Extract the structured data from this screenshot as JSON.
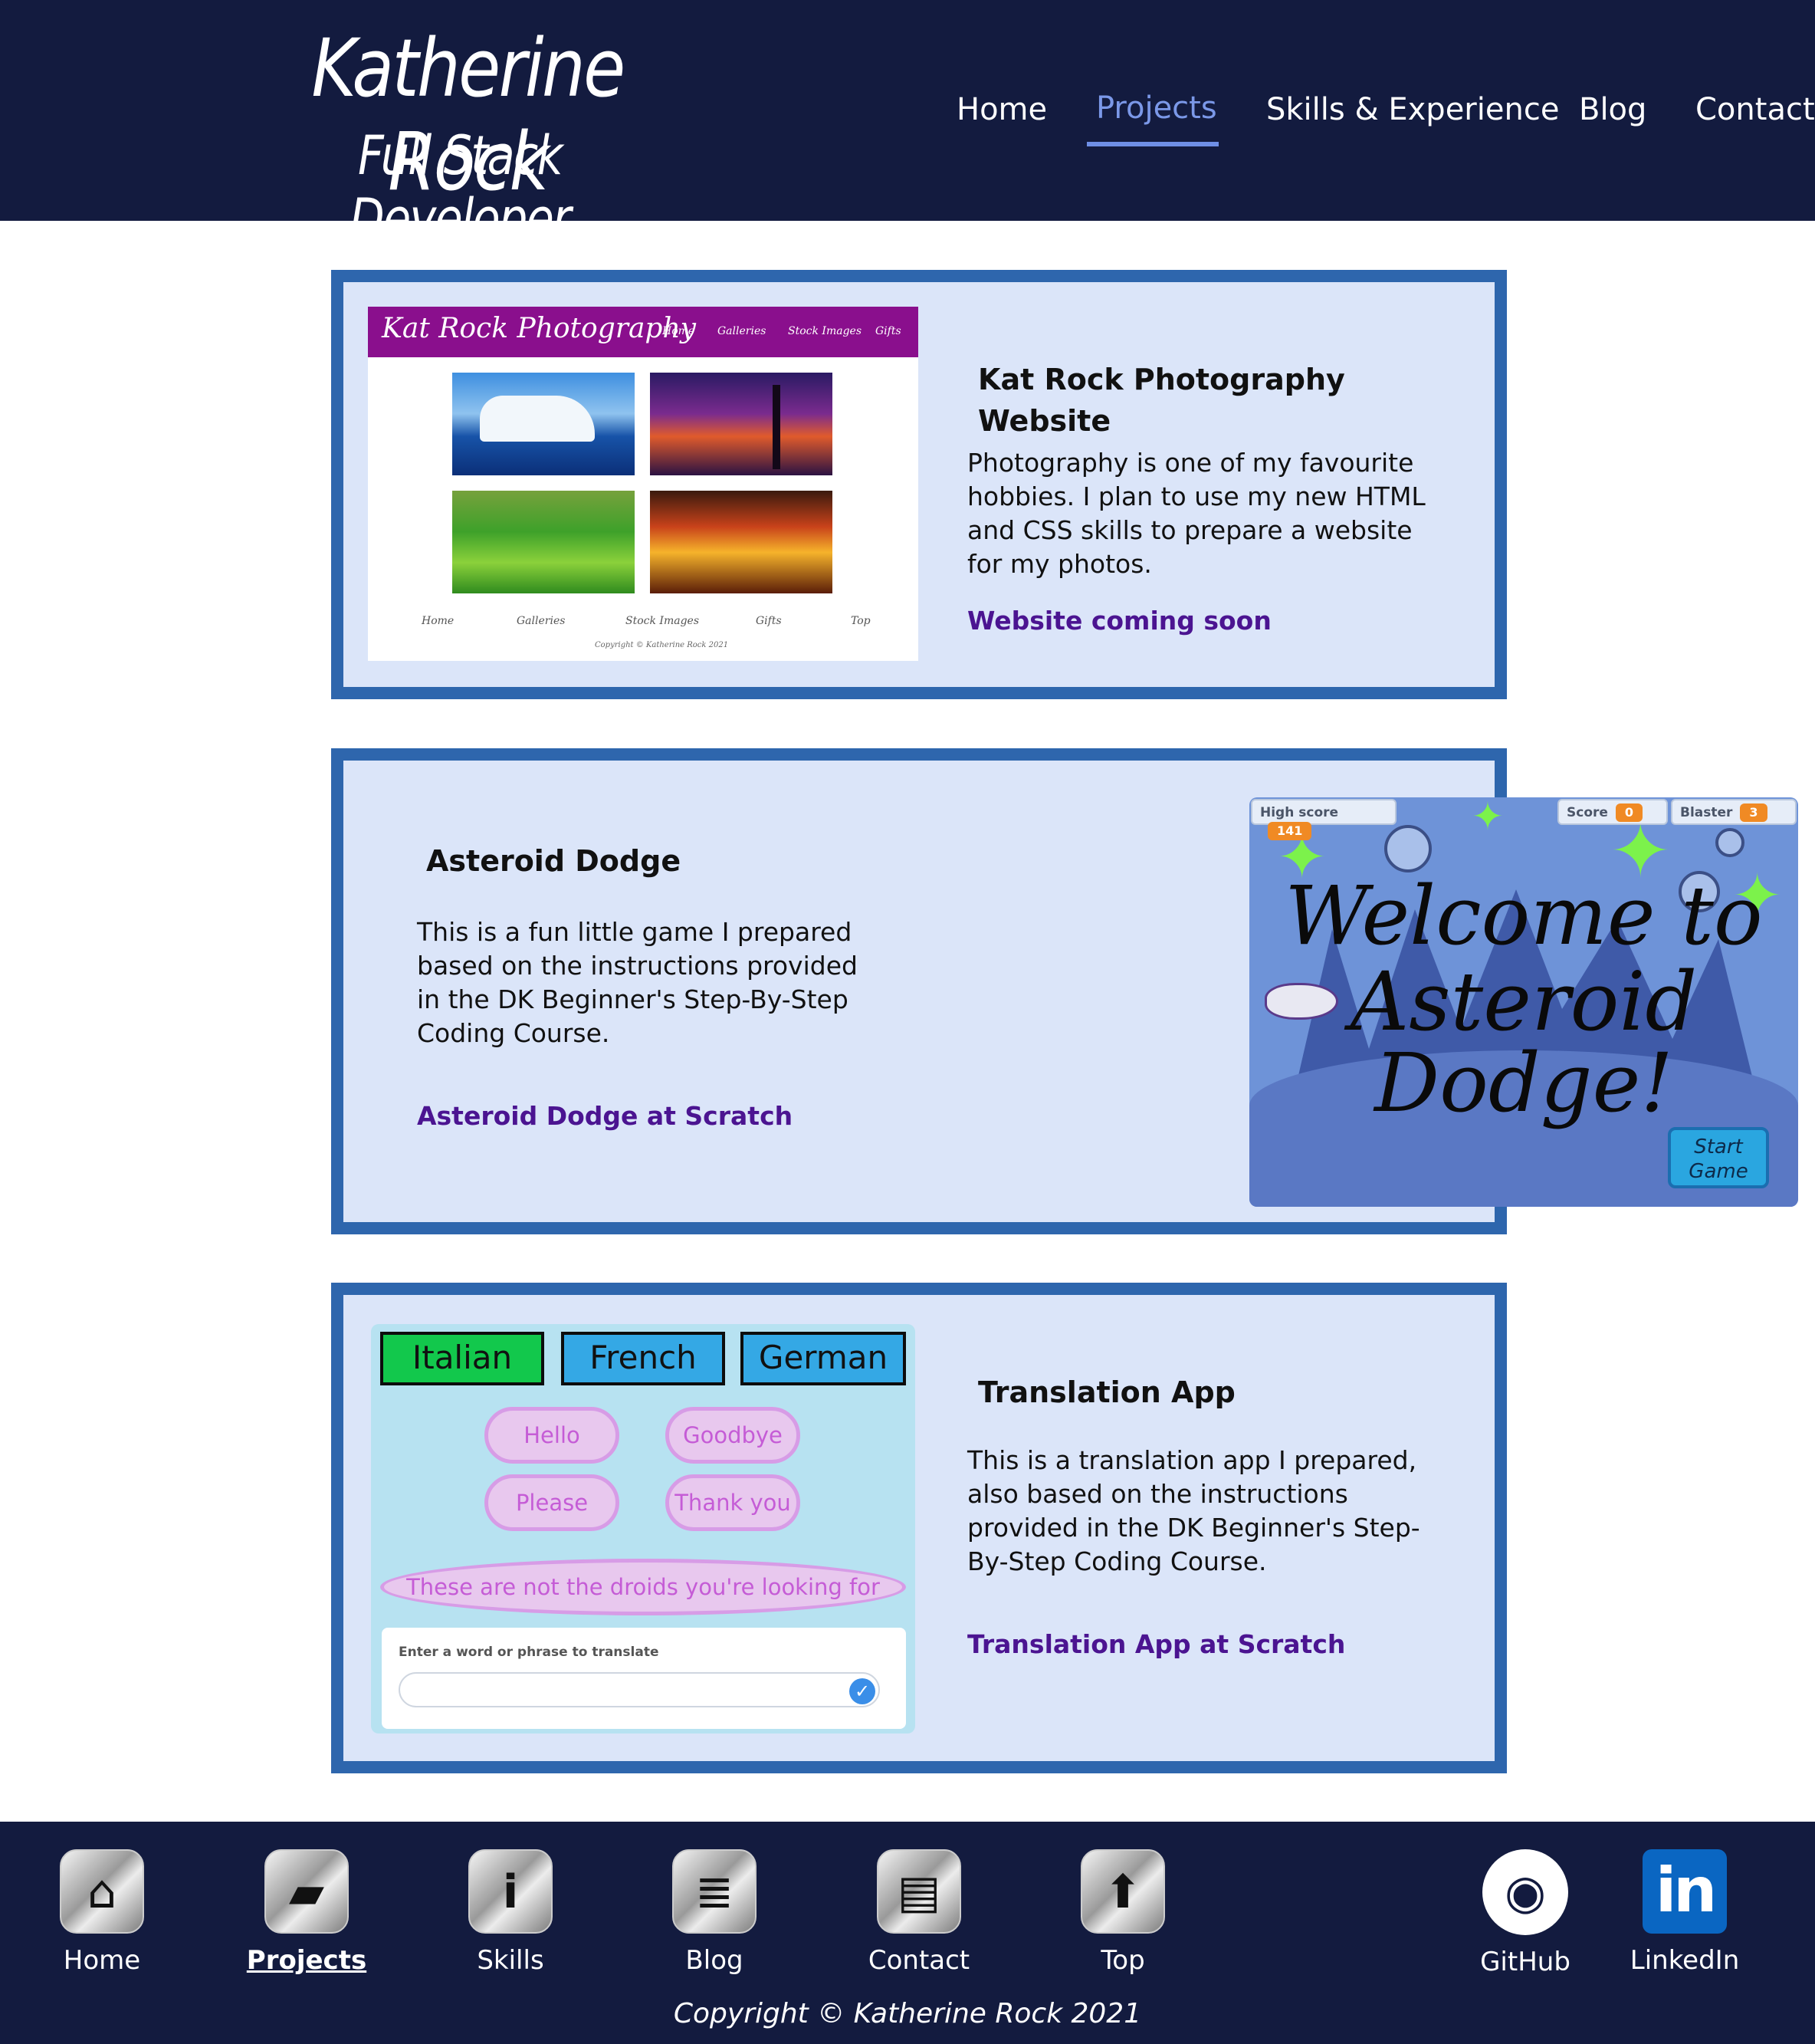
{
  "header": {
    "name": "Katherine Rock",
    "role": "Full Stack Developer",
    "nav": [
      "Home",
      "Projects",
      "Skills & Experience",
      "Blog",
      "Contact"
    ],
    "active_nav": "Projects"
  },
  "projects": [
    {
      "title": "Kat Rock Photography Website",
      "description": "Photography is one of my favourite hobbies. I plan to use my new HTML and CSS skills to prepare a website for my photos.",
      "link": "Website coming soon",
      "thumbnail": {
        "logo": "Kat Rock Photography",
        "nav": [
          "Home",
          "Galleries",
          "Stock Images",
          "Gifts"
        ],
        "footer_nav": [
          "Home",
          "Galleries",
          "Stock Images",
          "Gifts",
          "Top"
        ],
        "copyright": "Copyright © Katherine Rock 2021"
      }
    },
    {
      "title": "Asteroid Dodge",
      "description": "This is a fun little game I prepared based on the instructions provided in the DK Beginner's Step-By-Step Coding Course.",
      "link": "Asteroid Dodge at Scratch",
      "thumbnail": {
        "high_score_label": "High score",
        "high_score": "141",
        "score_label": "Score",
        "score": "0",
        "blaster_label": "Blaster",
        "blaster": "3",
        "title_line1": "Welcome to",
        "title_line2": "Asteroid",
        "title_line3": "Dodge!",
        "start_button": "Start Game"
      }
    },
    {
      "title": "Translation App",
      "description": "This is a translation app I prepared, also based on the instructions provided in the DK Beginner's Step-By-Step Coding Course.",
      "link": "Translation App at Scratch",
      "thumbnail": {
        "languages": [
          "Italian",
          "French",
          "German"
        ],
        "phrases": [
          "Hello",
          "Goodbye",
          "Please",
          "Thank you"
        ],
        "long_phrase": "These are not the droids you're looking for",
        "input_label": "Enter a word or phrase to translate",
        "input_value": ""
      }
    }
  ],
  "footer": {
    "nav": [
      {
        "label": "Home",
        "icon": "home-icon"
      },
      {
        "label": "Projects",
        "icon": "folder-icon"
      },
      {
        "label": "Skills",
        "icon": "info-icon"
      },
      {
        "label": "Blog",
        "icon": "document-icon"
      },
      {
        "label": "Contact",
        "icon": "contact-card-icon"
      },
      {
        "label": "Top",
        "icon": "arrow-up-icon"
      }
    ],
    "active": "Projects",
    "social": [
      {
        "label": "GitHub",
        "icon": "github-icon"
      },
      {
        "label": "LinkedIn",
        "icon": "linkedin-icon"
      }
    ],
    "copyright": "Copyright © Katherine Rock 2021"
  },
  "colors": {
    "navy": "#131b3f",
    "card_border": "#2e66ad",
    "card_bg": "#dbe5f9",
    "link": "#4b1491",
    "active_nav": "#7b98e8"
  }
}
